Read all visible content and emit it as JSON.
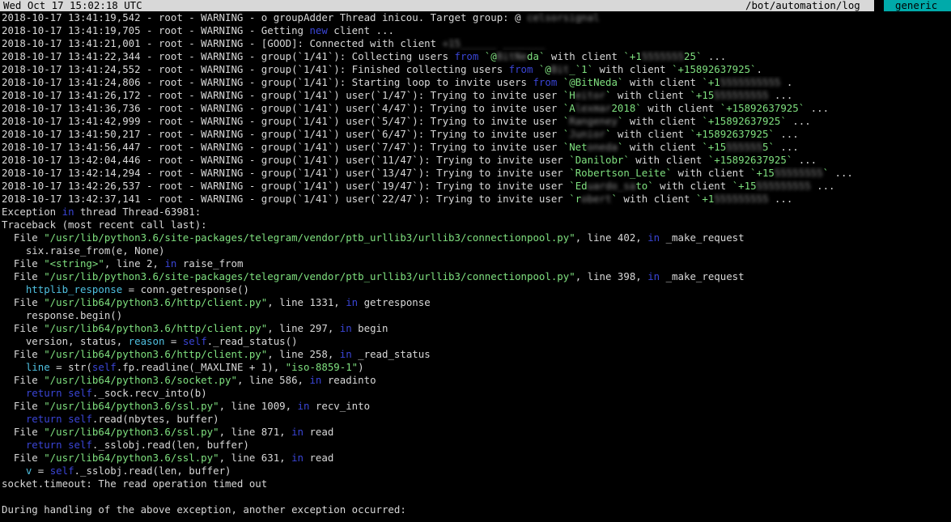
{
  "status_bar": {
    "datetime": "Wed Oct 17 15:02:18 UTC",
    "path": "/bot/automation/log",
    "session": "generic"
  },
  "colors": {
    "background": "#000000",
    "text": "#d8d8d8",
    "status_bar": "#d8d8d8",
    "session_accent": "#00aaaa",
    "keyword": "#3a45d6",
    "string": "#7fe07f",
    "identifier": "#4fc0e0"
  },
  "lines": [
    [
      {
        "t": "2018-10-17 13:41:19,542 - root - WARNING - o groupAdder Thread inicou. Target group: @ "
      },
      {
        "t": "celsorsignal",
        "c": "red"
      }
    ],
    [
      {
        "t": "2018-10-17 13:41:19,705 - root - WARNING - Getting "
      },
      {
        "t": "new",
        "c": "kw"
      },
      {
        "t": " client ..."
      }
    ],
    [
      {
        "t": "2018-10-17 13:41:21,001 - root - WARNING - [GOOD]: Connected with client "
      },
      {
        "t": "+15______ _______",
        "c": "red"
      }
    ],
    [
      {
        "t": "2018-10-17 13:41:22,344 - root - WARNING - group(`1/41`): Collecting users "
      },
      {
        "t": "from",
        "c": "kw"
      },
      {
        "t": " `@",
        "c": "str"
      },
      {
        "t": "BitNe",
        "c": "red"
      },
      {
        "t": "da`",
        "c": "str"
      },
      {
        "t": " with client "
      },
      {
        "t": "`+1",
        "c": "str"
      },
      {
        "t": "5555555",
        "c": "red"
      },
      {
        "t": "25`",
        "c": "str"
      },
      {
        "t": " ..."
      }
    ],
    [
      {
        "t": "2018-10-17 13:41:24,552 - root - WARNING - group(`1/41`): Finished collecting users "
      },
      {
        "t": "from",
        "c": "kw"
      },
      {
        "t": " `@",
        "c": "str"
      },
      {
        "t": "Bit",
        "c": "red"
      },
      {
        "t": "_`1`",
        "c": "str"
      },
      {
        "t": " with client "
      },
      {
        "t": "`+15892637925`",
        "c": "str"
      },
      {
        "t": "."
      }
    ],
    [
      {
        "t": "2018-10-17 13:41:24,806 - root - WARNING - group(`1/41`): Starting loop to invite users "
      },
      {
        "t": "from",
        "c": "kw"
      },
      {
        "t": " "
      },
      {
        "t": "`@BitNeda`",
        "c": "str"
      },
      {
        "t": " with client "
      },
      {
        "t": "`+1",
        "c": "str"
      },
      {
        "t": "5555555555",
        "c": "red"
      },
      {
        "t": " ."
      }
    ],
    [
      {
        "t": "2018-10-17 13:41:26,172 - root - WARNING - group(`1/41`) user(`1/47`): Trying to invite user "
      },
      {
        "t": "`H",
        "c": "str"
      },
      {
        "t": "eitor",
        "c": "red"
      },
      {
        "t": "`",
        "c": "str"
      },
      {
        "t": " with client "
      },
      {
        "t": "`+15",
        "c": "str"
      },
      {
        "t": "555555555",
        "c": "red"
      },
      {
        "t": " ..."
      }
    ],
    [
      {
        "t": "2018-10-17 13:41:36,736 - root - WARNING - group(`1/41`) user(`4/47`): Trying to invite user "
      },
      {
        "t": "`A",
        "c": "str"
      },
      {
        "t": "lexmar",
        "c": "red"
      },
      {
        "t": "2018`",
        "c": "str"
      },
      {
        "t": " with client "
      },
      {
        "t": "`+15892637925`",
        "c": "str"
      },
      {
        "t": " ..."
      }
    ],
    [
      {
        "t": "2018-10-17 13:41:42,999 - root - WARNING - group(`1/41`) user(`5/47`): Trying to invite user "
      },
      {
        "t": "`",
        "c": "str"
      },
      {
        "t": "Rangeney",
        "c": "red"
      },
      {
        "t": "`",
        "c": "str"
      },
      {
        "t": " with client "
      },
      {
        "t": "`+15892637925`",
        "c": "str"
      },
      {
        "t": " ..."
      }
    ],
    [
      {
        "t": "2018-10-17 13:41:50,217 - root - WARNING - group(`1/41`) user(`6/47`): Trying to invite user "
      },
      {
        "t": "`",
        "c": "str"
      },
      {
        "t": "Junior",
        "c": "red"
      },
      {
        "t": "`",
        "c": "str"
      },
      {
        "t": " with client "
      },
      {
        "t": "`+15892637925`",
        "c": "str"
      },
      {
        "t": " ..."
      }
    ],
    [
      {
        "t": "2018-10-17 13:41:56,447 - root - WARNING - group(`1/41`) user(`7/47`): Trying to invite user "
      },
      {
        "t": "`Net",
        "c": "str"
      },
      {
        "t": "oneda",
        "c": "red"
      },
      {
        "t": "`",
        "c": "str"
      },
      {
        "t": " with client "
      },
      {
        "t": "`+15",
        "c": "str"
      },
      {
        "t": "555555",
        "c": "red"
      },
      {
        "t": "5`",
        "c": "str"
      },
      {
        "t": " ..."
      }
    ],
    [
      {
        "t": "2018-10-17 13:42:04,446 - root - WARNING - group(`1/41`) user(`11/47`): Trying to invite user "
      },
      {
        "t": "`Danilobr`",
        "c": "str"
      },
      {
        "t": " with client "
      },
      {
        "t": "`+15892637925`",
        "c": "str"
      },
      {
        "t": " ..."
      }
    ],
    [
      {
        "t": "2018-10-17 13:42:14,294 - root - WARNING - group(`1/41`) user(`13/47`): Trying to invite user "
      },
      {
        "t": "`Robertson_Leite`",
        "c": "str"
      },
      {
        "t": " with client "
      },
      {
        "t": "`+15",
        "c": "str"
      },
      {
        "t": "55555555",
        "c": "red"
      },
      {
        "t": "`",
        "c": "str"
      },
      {
        "t": " ..."
      }
    ],
    [
      {
        "t": "2018-10-17 13:42:26,537 - root - WARNING - group(`1/41`) user(`19/47`): Trying to invite user "
      },
      {
        "t": "`Ed",
        "c": "str"
      },
      {
        "t": "uardo_sa",
        "c": "red"
      },
      {
        "t": "to`",
        "c": "str"
      },
      {
        "t": " with client "
      },
      {
        "t": "`+15",
        "c": "str"
      },
      {
        "t": "555555555",
        "c": "red"
      },
      {
        "t": " ..."
      }
    ],
    [
      {
        "t": "2018-10-17 13:42:37,141 - root - WARNING - group(`1/41`) user(`22/47`): Trying to invite user "
      },
      {
        "t": "`r",
        "c": "str"
      },
      {
        "t": "obert",
        "c": "red"
      },
      {
        "t": "`",
        "c": "str"
      },
      {
        "t": " with client "
      },
      {
        "t": "`+1",
        "c": "str"
      },
      {
        "t": "555555555",
        "c": "red"
      },
      {
        "t": " ..."
      }
    ],
    [
      {
        "t": "Exception "
      },
      {
        "t": "in",
        "c": "kw"
      },
      {
        "t": " thread Thread-63981:"
      }
    ],
    [
      {
        "t": "Traceback (most recent call last):"
      }
    ],
    [
      {
        "t": "  File "
      },
      {
        "t": "\"/usr/lib/python3.6/site-packages/telegram/vendor/ptb_urllib3/urllib3/connectionpool.py\"",
        "c": "str"
      },
      {
        "t": ", line 402, "
      },
      {
        "t": "in",
        "c": "kw"
      },
      {
        "t": " _make_request"
      }
    ],
    [
      {
        "t": "    six.raise_from(e, None)"
      }
    ],
    [
      {
        "t": "  File "
      },
      {
        "t": "\"<string>\"",
        "c": "str"
      },
      {
        "t": ", line 2, "
      },
      {
        "t": "in",
        "c": "kw"
      },
      {
        "t": " raise_from"
      }
    ],
    [
      {
        "t": "  File "
      },
      {
        "t": "\"/usr/lib/python3.6/site-packages/telegram/vendor/ptb_urllib3/urllib3/connectionpool.py\"",
        "c": "str"
      },
      {
        "t": ", line 398, "
      },
      {
        "t": "in",
        "c": "kw"
      },
      {
        "t": " _make_request"
      }
    ],
    [
      {
        "t": "    "
      },
      {
        "t": "httplib_response",
        "c": "id"
      },
      {
        "t": " = conn.getresponse()"
      }
    ],
    [
      {
        "t": "  File "
      },
      {
        "t": "\"/usr/lib64/python3.6/http/client.py\"",
        "c": "str"
      },
      {
        "t": ", line 1331, "
      },
      {
        "t": "in",
        "c": "kw"
      },
      {
        "t": " getresponse"
      }
    ],
    [
      {
        "t": "    response.begin()"
      }
    ],
    [
      {
        "t": "  File "
      },
      {
        "t": "\"/usr/lib64/python3.6/http/client.py\"",
        "c": "str"
      },
      {
        "t": ", line 297, "
      },
      {
        "t": "in",
        "c": "kw"
      },
      {
        "t": " begin"
      }
    ],
    [
      {
        "t": "    version, status, "
      },
      {
        "t": "reason",
        "c": "id"
      },
      {
        "t": " = "
      },
      {
        "t": "self",
        "c": "kw"
      },
      {
        "t": "._read_status()"
      }
    ],
    [
      {
        "t": "  File "
      },
      {
        "t": "\"/usr/lib64/python3.6/http/client.py\"",
        "c": "str"
      },
      {
        "t": ", line 258, "
      },
      {
        "t": "in",
        "c": "kw"
      },
      {
        "t": " _read_status"
      }
    ],
    [
      {
        "t": "    "
      },
      {
        "t": "line",
        "c": "id"
      },
      {
        "t": " = str("
      },
      {
        "t": "self",
        "c": "kw"
      },
      {
        "t": ".fp.readline(_MAXLINE + 1), "
      },
      {
        "t": "\"iso-8859-1\"",
        "c": "str"
      },
      {
        "t": ")"
      }
    ],
    [
      {
        "t": "  File "
      },
      {
        "t": "\"/usr/lib64/python3.6/socket.py\"",
        "c": "str"
      },
      {
        "t": ", line 586, "
      },
      {
        "t": "in",
        "c": "kw"
      },
      {
        "t": " readinto"
      }
    ],
    [
      {
        "t": "    "
      },
      {
        "t": "return",
        "c": "kw"
      },
      {
        "t": " "
      },
      {
        "t": "self",
        "c": "kw"
      },
      {
        "t": "._sock.recv_into(b)"
      }
    ],
    [
      {
        "t": "  File "
      },
      {
        "t": "\"/usr/lib64/python3.6/ssl.py\"",
        "c": "str"
      },
      {
        "t": ", line 1009, "
      },
      {
        "t": "in",
        "c": "kw"
      },
      {
        "t": " recv_into"
      }
    ],
    [
      {
        "t": "    "
      },
      {
        "t": "return",
        "c": "kw"
      },
      {
        "t": " "
      },
      {
        "t": "self",
        "c": "kw"
      },
      {
        "t": ".read(nbytes, buffer)"
      }
    ],
    [
      {
        "t": "  File "
      },
      {
        "t": "\"/usr/lib64/python3.6/ssl.py\"",
        "c": "str"
      },
      {
        "t": ", line 871, "
      },
      {
        "t": "in",
        "c": "kw"
      },
      {
        "t": " read"
      }
    ],
    [
      {
        "t": "    "
      },
      {
        "t": "return",
        "c": "kw"
      },
      {
        "t": " "
      },
      {
        "t": "self",
        "c": "kw"
      },
      {
        "t": "._sslobj.read(len, buffer)"
      }
    ],
    [
      {
        "t": "  File "
      },
      {
        "t": "\"/usr/lib64/python3.6/ssl.py\"",
        "c": "str"
      },
      {
        "t": ", line 631, "
      },
      {
        "t": "in",
        "c": "kw"
      },
      {
        "t": " read"
      }
    ],
    [
      {
        "t": "    "
      },
      {
        "t": "v",
        "c": "id"
      },
      {
        "t": " = "
      },
      {
        "t": "self",
        "c": "kw"
      },
      {
        "t": "._sslobj.read(len, buffer)"
      }
    ],
    [
      {
        "t": "socket.timeout: The read operation timed out"
      }
    ],
    [
      {
        "t": ""
      }
    ],
    [
      {
        "t": "During handling of the above exception, another exception occurred:"
      }
    ]
  ]
}
